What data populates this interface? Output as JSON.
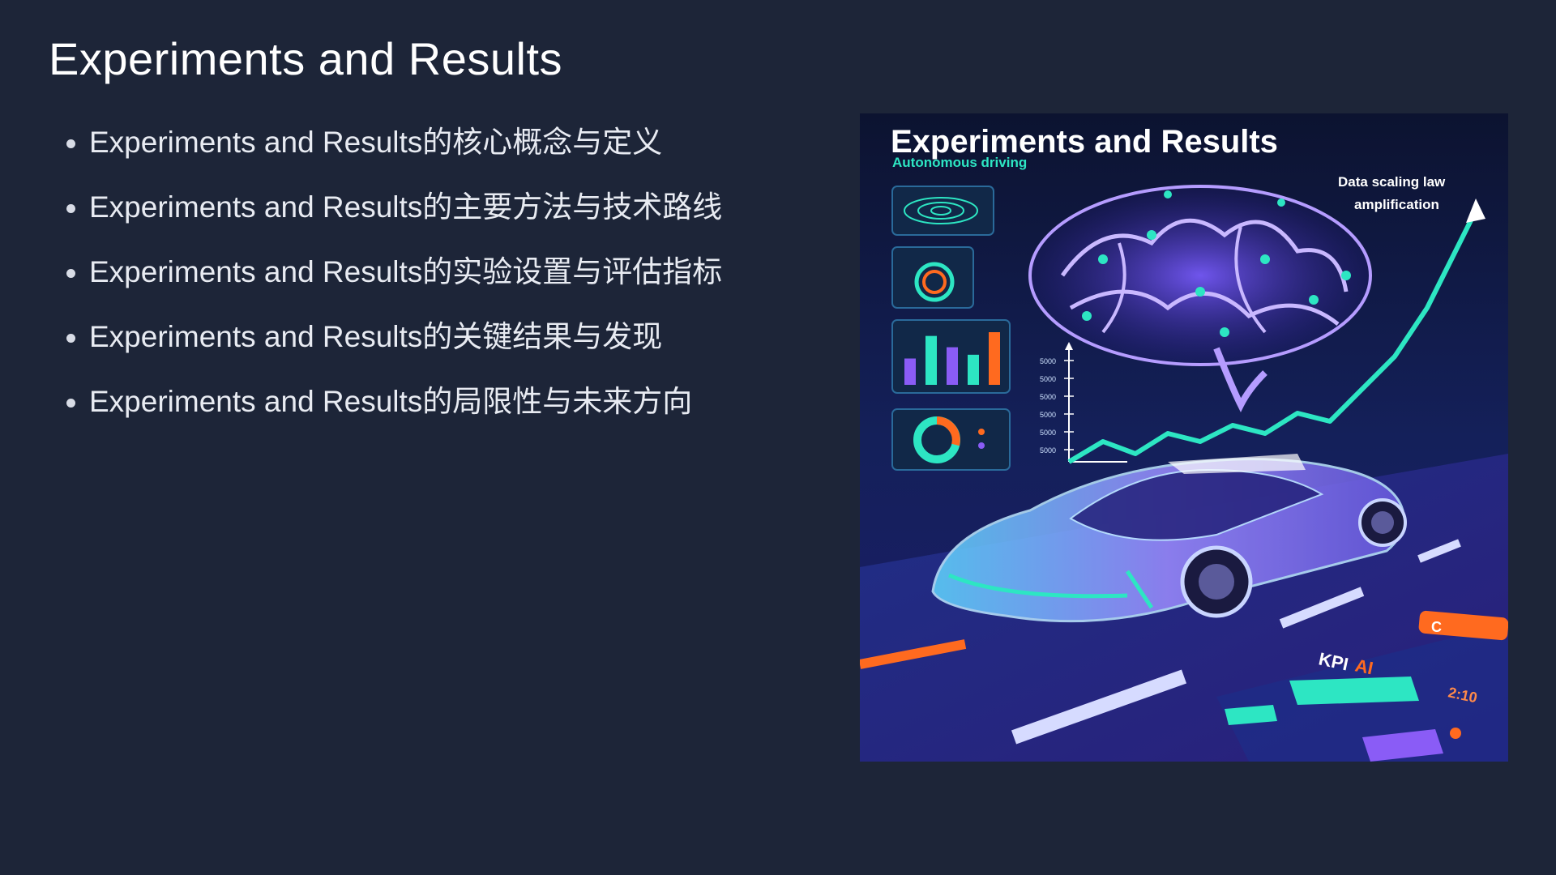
{
  "slide": {
    "title": "Experiments and Results",
    "bullets": [
      "Experiments and Results的核心概念与定义",
      "Experiments and Results的主要方法与技术路线",
      "Experiments and Results的实验设置与评估指标",
      "Experiments and Results的关键结果与发现",
      "Experiments and Results的局限性与未来方向"
    ]
  },
  "illustration": {
    "title": "Experiments and Results",
    "subtitle": "Autonomous driving",
    "caption_line1": "Data scaling law",
    "caption_line2": "amplification",
    "kpi_label": "KPI",
    "kpi_suffix": "AI",
    "orange_tag": "C",
    "bottom_value": "2:10",
    "colors": {
      "background": "#1d2538",
      "accent_teal": "#2de6c3",
      "accent_purple": "#8a5cf6",
      "accent_orange": "#ff6a1f"
    },
    "bar_values": [
      35,
      65,
      50,
      40,
      70
    ],
    "axis_ticks": [
      "5000",
      "5000",
      "5000",
      "5000",
      "5000",
      "5000"
    ]
  }
}
